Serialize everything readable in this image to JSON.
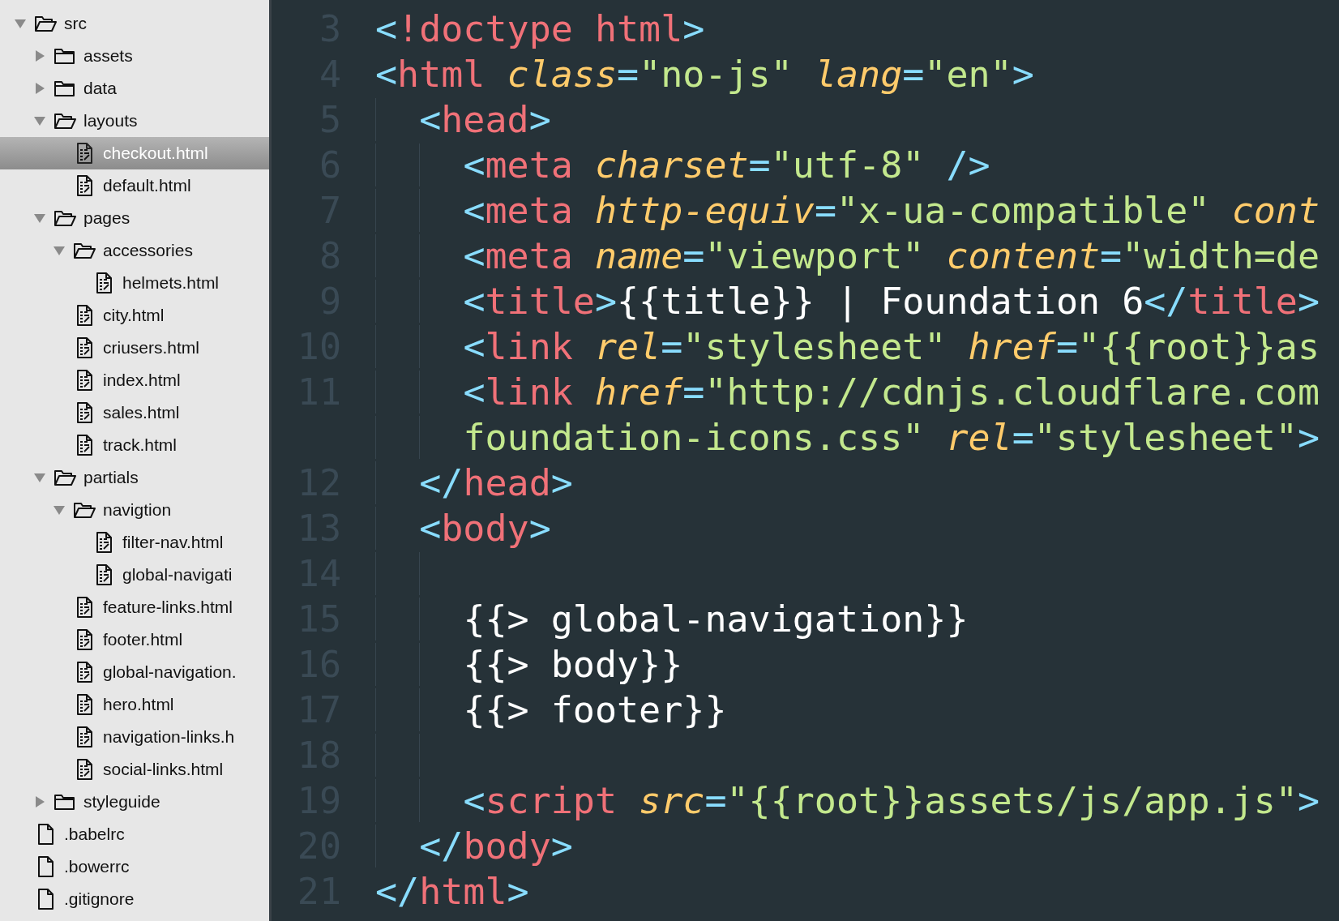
{
  "sidebar": {
    "tree": [
      {
        "name": "src",
        "kind": "folder",
        "expanded": true,
        "selected": false,
        "children": [
          {
            "name": "assets",
            "kind": "folder",
            "expanded": false,
            "selected": false
          },
          {
            "name": "data",
            "kind": "folder",
            "expanded": false,
            "selected": false
          },
          {
            "name": "layouts",
            "kind": "folder",
            "expanded": true,
            "selected": false,
            "children": [
              {
                "name": "checkout.html",
                "kind": "html-file",
                "selected": true
              },
              {
                "name": "default.html",
                "kind": "html-file",
                "selected": false
              }
            ]
          },
          {
            "name": "pages",
            "kind": "folder",
            "expanded": true,
            "selected": false,
            "children": [
              {
                "name": "accessories",
                "kind": "folder",
                "expanded": true,
                "selected": false,
                "children": [
                  {
                    "name": "helmets.html",
                    "kind": "html-file",
                    "selected": false
                  }
                ]
              },
              {
                "name": "city.html",
                "kind": "html-file",
                "selected": false
              },
              {
                "name": "criusers.html",
                "kind": "html-file",
                "selected": false
              },
              {
                "name": "index.html",
                "kind": "html-file",
                "selected": false
              },
              {
                "name": "sales.html",
                "kind": "html-file",
                "selected": false
              },
              {
                "name": "track.html",
                "kind": "html-file",
                "selected": false
              }
            ]
          },
          {
            "name": "partials",
            "kind": "folder",
            "expanded": true,
            "selected": false,
            "children": [
              {
                "name": "navigtion",
                "kind": "folder",
                "expanded": true,
                "selected": false,
                "children": [
                  {
                    "name": "filter-nav.html",
                    "kind": "html-file",
                    "selected": false
                  },
                  {
                    "name": "global-navigati",
                    "kind": "html-file",
                    "selected": false
                  }
                ]
              },
              {
                "name": "feature-links.html",
                "kind": "html-file",
                "selected": false
              },
              {
                "name": "footer.html",
                "kind": "html-file",
                "selected": false
              },
              {
                "name": "global-navigation.",
                "kind": "html-file",
                "selected": false
              },
              {
                "name": "hero.html",
                "kind": "html-file",
                "selected": false
              },
              {
                "name": "navigation-links.h",
                "kind": "html-file",
                "selected": false
              },
              {
                "name": "social-links.html",
                "kind": "html-file",
                "selected": false
              }
            ]
          },
          {
            "name": "styleguide",
            "kind": "folder",
            "expanded": false,
            "selected": false
          }
        ]
      },
      {
        "name": ".babelrc",
        "kind": "file",
        "selected": false
      },
      {
        "name": ".bowerrc",
        "kind": "file",
        "selected": false
      },
      {
        "name": ".gitignore",
        "kind": "file",
        "selected": false
      }
    ]
  },
  "editor": {
    "lines": [
      {
        "number": "3",
        "tokens": [
          {
            "kind": "punct",
            "text": "<"
          },
          {
            "kind": "tag",
            "text": "!doctype html"
          },
          {
            "kind": "punct",
            "text": ">"
          }
        ]
      },
      {
        "number": "4",
        "tokens": [
          {
            "kind": "punct",
            "text": "<"
          },
          {
            "kind": "tag",
            "text": "html "
          },
          {
            "kind": "attr",
            "text": "class"
          },
          {
            "kind": "punct",
            "text": "="
          },
          {
            "kind": "string",
            "text": "\"no-js\" "
          },
          {
            "kind": "attr",
            "text": "lang"
          },
          {
            "kind": "punct",
            "text": "="
          },
          {
            "kind": "string",
            "text": "\"en\""
          },
          {
            "kind": "punct",
            "text": ">"
          }
        ]
      },
      {
        "number": "5",
        "tokens": [
          {
            "kind": "punct",
            "text": "  <"
          },
          {
            "kind": "tag",
            "text": "head"
          },
          {
            "kind": "punct",
            "text": ">"
          }
        ]
      },
      {
        "number": "6",
        "tokens": [
          {
            "kind": "punct",
            "text": "    <"
          },
          {
            "kind": "tag",
            "text": "meta "
          },
          {
            "kind": "attr",
            "text": "charset"
          },
          {
            "kind": "punct",
            "text": "="
          },
          {
            "kind": "string",
            "text": "\"utf-8\" "
          },
          {
            "kind": "punct",
            "text": "/>"
          }
        ]
      },
      {
        "number": "7",
        "tokens": [
          {
            "kind": "punct",
            "text": "    <"
          },
          {
            "kind": "tag",
            "text": "meta "
          },
          {
            "kind": "attr",
            "text": "http-equiv"
          },
          {
            "kind": "punct",
            "text": "="
          },
          {
            "kind": "string",
            "text": "\"x-ua-compatible\" "
          },
          {
            "kind": "attr",
            "text": "cont"
          }
        ]
      },
      {
        "number": "8",
        "tokens": [
          {
            "kind": "punct",
            "text": "    <"
          },
          {
            "kind": "tag",
            "text": "meta "
          },
          {
            "kind": "attr",
            "text": "name"
          },
          {
            "kind": "punct",
            "text": "="
          },
          {
            "kind": "string",
            "text": "\"viewport\" "
          },
          {
            "kind": "attr",
            "text": "content"
          },
          {
            "kind": "punct",
            "text": "="
          },
          {
            "kind": "string",
            "text": "\"width=de"
          }
        ]
      },
      {
        "number": "9",
        "tokens": [
          {
            "kind": "punct",
            "text": "    <"
          },
          {
            "kind": "tag",
            "text": "title"
          },
          {
            "kind": "punct",
            "text": ">"
          },
          {
            "kind": "plain",
            "text": "{{title}} | Foundation 6"
          },
          {
            "kind": "punct",
            "text": "</"
          },
          {
            "kind": "tag",
            "text": "title"
          },
          {
            "kind": "punct",
            "text": ">"
          }
        ]
      },
      {
        "number": "10",
        "tokens": [
          {
            "kind": "punct",
            "text": "    <"
          },
          {
            "kind": "tag",
            "text": "link "
          },
          {
            "kind": "attr",
            "text": "rel"
          },
          {
            "kind": "punct",
            "text": "="
          },
          {
            "kind": "string",
            "text": "\"stylesheet\" "
          },
          {
            "kind": "attr",
            "text": "href"
          },
          {
            "kind": "punct",
            "text": "="
          },
          {
            "kind": "string",
            "text": "\"{{root}}as"
          }
        ]
      },
      {
        "number": "11",
        "tokens": [
          {
            "kind": "punct",
            "text": "    <"
          },
          {
            "kind": "tag",
            "text": "link "
          },
          {
            "kind": "attr",
            "text": "href"
          },
          {
            "kind": "punct",
            "text": "="
          },
          {
            "kind": "string",
            "text": "\"http://cdnjs.cloudflare.com"
          }
        ]
      },
      {
        "tokens": [
          {
            "kind": "string",
            "text": "    foundation-icons.css\" "
          },
          {
            "kind": "attr",
            "text": "rel"
          },
          {
            "kind": "punct",
            "text": "="
          },
          {
            "kind": "string",
            "text": "\"stylesheet\""
          },
          {
            "kind": "punct",
            "text": ">"
          }
        ]
      },
      {
        "number": "12",
        "tokens": [
          {
            "kind": "punct",
            "text": "  </"
          },
          {
            "kind": "tag",
            "text": "head"
          },
          {
            "kind": "punct",
            "text": ">"
          }
        ]
      },
      {
        "number": "13",
        "tokens": [
          {
            "kind": "punct",
            "text": "  <"
          },
          {
            "kind": "tag",
            "text": "body"
          },
          {
            "kind": "punct",
            "text": ">"
          }
        ]
      },
      {
        "number": "14"
      },
      {
        "number": "15",
        "tokens": [
          {
            "kind": "plain",
            "text": "    {{> global-navigation}}"
          }
        ]
      },
      {
        "number": "16",
        "tokens": [
          {
            "kind": "plain",
            "text": "    {{> body}}"
          }
        ]
      },
      {
        "number": "17",
        "tokens": [
          {
            "kind": "plain",
            "text": "    {{> footer}}"
          }
        ]
      },
      {
        "number": "18"
      },
      {
        "number": "19",
        "tokens": [
          {
            "kind": "punct",
            "text": "    <"
          },
          {
            "kind": "tag",
            "text": "script "
          },
          {
            "kind": "attr",
            "text": "src"
          },
          {
            "kind": "punct",
            "text": "="
          },
          {
            "kind": "string",
            "text": "\"{{root}}assets/js/app.js\""
          },
          {
            "kind": "punct",
            "text": ">"
          }
        ]
      },
      {
        "number": "20",
        "tokens": [
          {
            "kind": "punct",
            "text": "  </"
          },
          {
            "kind": "tag",
            "text": "body"
          },
          {
            "kind": "punct",
            "text": ">"
          }
        ]
      },
      {
        "number": "21",
        "tokens": [
          {
            "kind": "punct",
            "text": "</"
          },
          {
            "kind": "tag",
            "text": "html"
          },
          {
            "kind": "punct",
            "text": ">"
          }
        ]
      }
    ]
  }
}
